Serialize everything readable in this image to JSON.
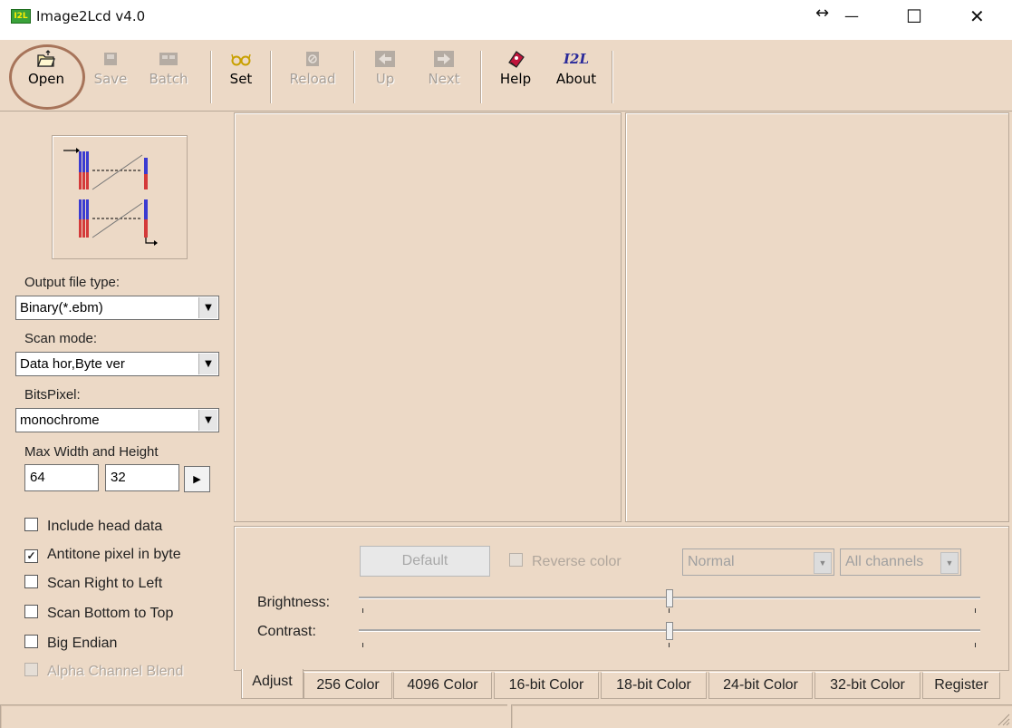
{
  "window": {
    "title": "Image2Lcd v4.0",
    "icon_text": "I2L",
    "resize_glyph": "↔",
    "minimize_glyph": "—",
    "maximize_glyph": "☐",
    "close_glyph": "✕"
  },
  "toolbar": {
    "open": "Open",
    "save": "Save",
    "batch": "Batch",
    "set": "Set",
    "reload": "Reload",
    "up": "Up",
    "next": "Next",
    "help": "Help",
    "about": "About",
    "about_icon_text": "I2L"
  },
  "settings": {
    "output_file_type_label": "Output file type:",
    "output_file_type_value": "Binary(*.ebm)",
    "scan_mode_label": "Scan mode:",
    "scan_mode_value": "Data hor,Byte ver",
    "bits_pixel_label": "BitsPixel:",
    "bits_pixel_value": "monochrome",
    "max_size_label": "Max Width and Height",
    "max_width": "64",
    "max_height": "32",
    "checkboxes": [
      {
        "label": "Include head data",
        "checked": false
      },
      {
        "label": "Antitone pixel in byte",
        "checked": true
      },
      {
        "label": "Scan Right to Left",
        "checked": false
      },
      {
        "label": "Scan Bottom to Top",
        "checked": false
      },
      {
        "label": "Big Endian",
        "checked": false
      },
      {
        "label": "Alpha Channel Blend",
        "checked": false
      }
    ],
    "check_glyph": "✓"
  },
  "adjust": {
    "default_button": "Default",
    "reverse_color": "Reverse color",
    "mode_value": "Normal",
    "channel_value": "All channels",
    "brightness_label": "Brightness:",
    "contrast_label": "Contrast:",
    "brightness_level": 0.5,
    "contrast_level": 0.5
  },
  "tabs": [
    {
      "label": "Adjust",
      "active": true
    },
    {
      "label": "256 Color"
    },
    {
      "label": "4096 Color"
    },
    {
      "label": "16-bit Color"
    },
    {
      "label": "18-bit Color"
    },
    {
      "label": "24-bit Color"
    },
    {
      "label": "32-bit Color"
    },
    {
      "label": "Register"
    }
  ],
  "colors": {
    "background": "#ecd9c6",
    "highlight_ring": "#a7745a"
  }
}
